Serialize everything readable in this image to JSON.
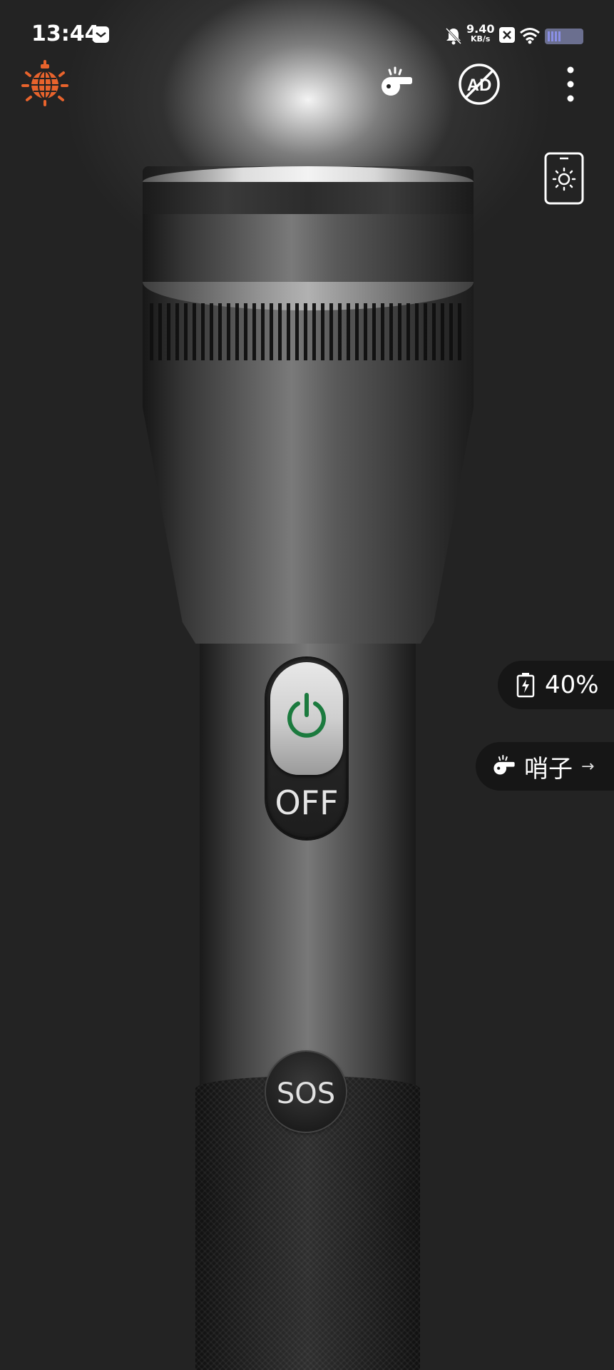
{
  "status_bar": {
    "time": "13:44",
    "net_speed_value": "9.40",
    "net_speed_unit": "KB/s",
    "icons": [
      "message-icon",
      "bell-muted-icon",
      "x-box-icon",
      "wifi-icon",
      "battery-icon"
    ]
  },
  "toolbar": {
    "left_icon": "timer-disco-icon",
    "whistle_icon": "whistle-icon",
    "no_ads_label": "AD",
    "more_icon": "more-vertical-icon",
    "screen_light_icon": "phone-brightness-icon"
  },
  "flashlight": {
    "power_state": "OFF",
    "sos_label": "SOS"
  },
  "side_panel": {
    "battery_text": "40%",
    "whistle_label": "哨子",
    "whistle_arrow": "→"
  },
  "colors": {
    "background": "#232323",
    "accent_orange": "#e8632c",
    "power_green": "#1b7a3e"
  }
}
